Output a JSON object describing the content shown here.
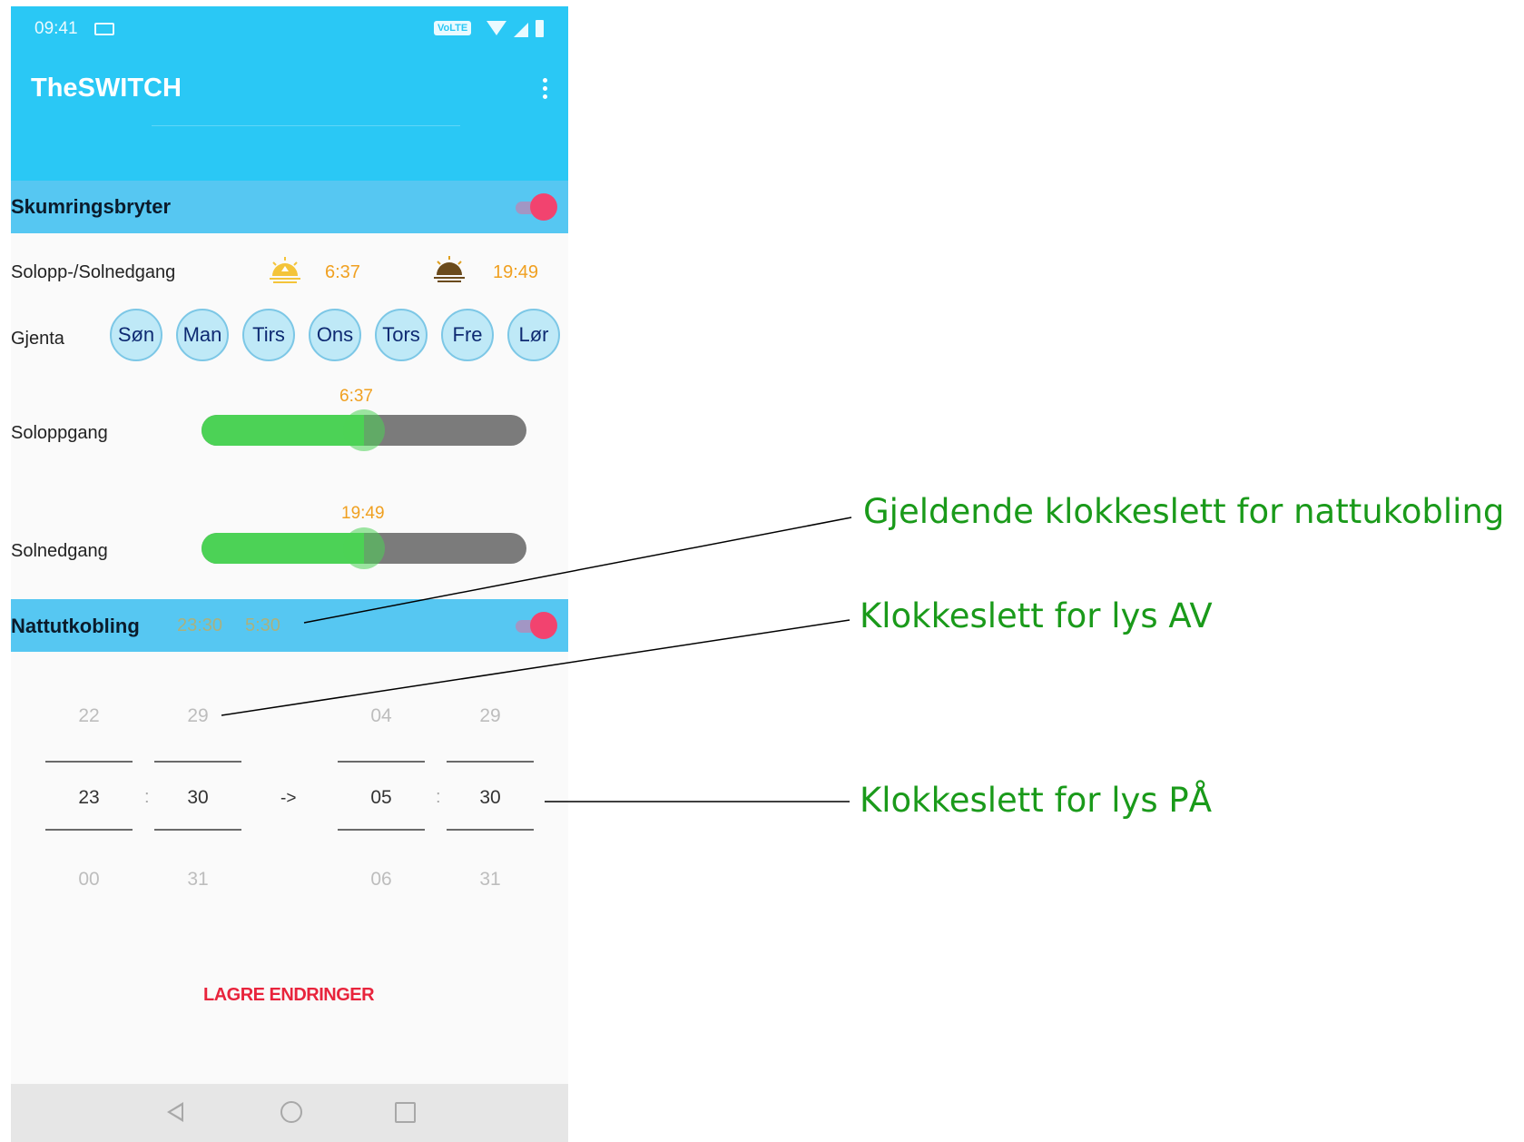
{
  "status_bar": {
    "time": "09:41",
    "volte": "VoLTE"
  },
  "app_bar": {
    "title": "TheSWITCH"
  },
  "twilight_switch": {
    "title": "Skumringsbryter",
    "enabled": true
  },
  "sun_row": {
    "label": "Solopp-/Solnedgang",
    "sunrise_time": "6:37",
    "sunset_time": "19:49"
  },
  "repeat_row": {
    "label": "Gjenta",
    "days": [
      "Søn",
      "Man",
      "Tirs",
      "Ons",
      "Tors",
      "Fre",
      "Lør"
    ]
  },
  "sunrise_slider": {
    "label": "Soloppgang",
    "value_text": "6:37",
    "fraction": 0.5
  },
  "sunset_slider": {
    "label": "Solnedgang",
    "value_text": "19:49",
    "fraction": 0.5
  },
  "night_switch": {
    "title": "Nattutkobling",
    "time_off": "23:30",
    "time_on": "5:30",
    "enabled": true
  },
  "pickers": {
    "off_hour": {
      "prev": "22",
      "selected": "23",
      "next": "00"
    },
    "off_minute": {
      "prev": "29",
      "selected": "30",
      "next": "31"
    },
    "on_hour": {
      "prev": "04",
      "selected": "05",
      "next": "06"
    },
    "on_minute": {
      "prev": "29",
      "selected": "30",
      "next": "31"
    },
    "separator": ":",
    "arrow": "->"
  },
  "save_button": {
    "label": "LAGRE ENDRINGER"
  },
  "annotations": {
    "current_night_time": "Gjeldende klokkeslett for nattukobling",
    "lights_off_time": "Klokkeslett for lys AV",
    "lights_on_time": "Klokkeslett for lys PÅ",
    "color": "#1a9a1a"
  },
  "colors": {
    "accent": "#2ac8f5",
    "header": "#56c7f2",
    "toggle": "#f2436f",
    "slider_fill": "#4cd256",
    "time_text": "#f0a020",
    "save": "#e8243c"
  }
}
